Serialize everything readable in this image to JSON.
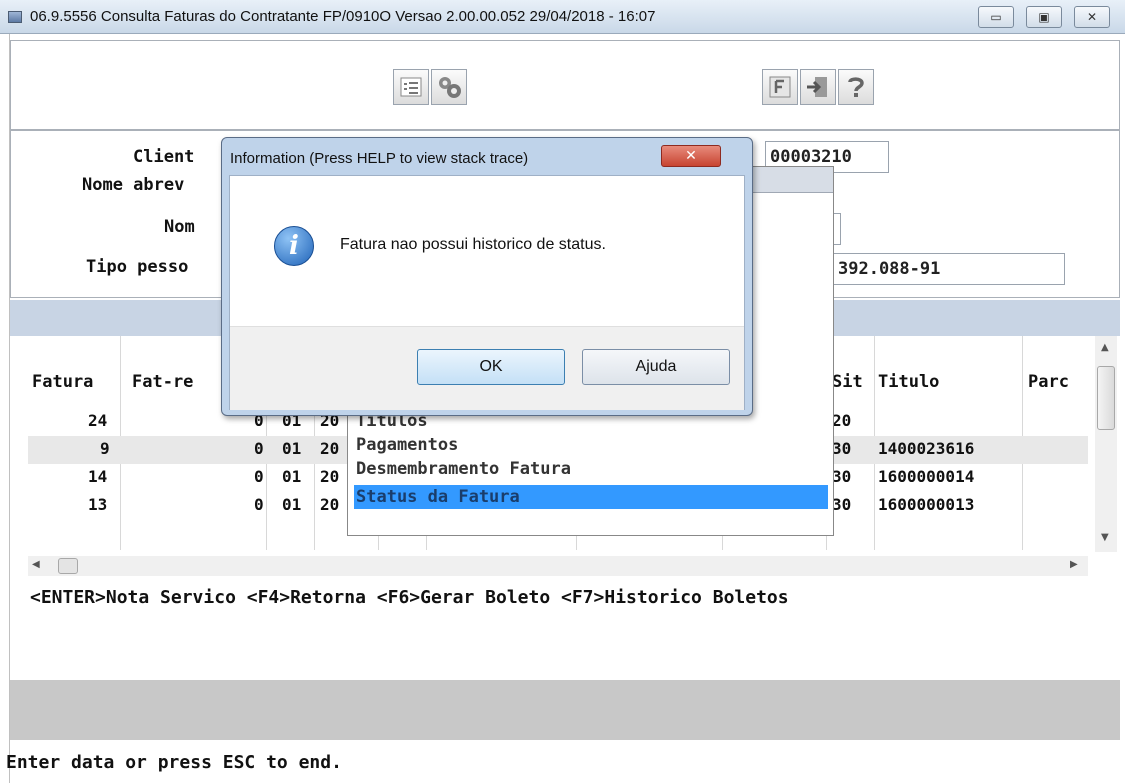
{
  "window": {
    "title": "06.9.5556 Consulta  Faturas do Contratante FP/0910O Versao 2.00.00.052 29/04/2018 - 16:07",
    "minimize": "▭",
    "maximize": "▣",
    "close": "✕"
  },
  "toolbar": {
    "icons": [
      "list-check-icon",
      "gears-icon",
      "first-icon",
      "exit-door-icon",
      "help-icon"
    ]
  },
  "header": {
    "labels": [
      "Client",
      "Nome abrev",
      "Nom",
      "Tipo pesso"
    ],
    "fields": [
      "00003210",
      "",
      "392.088-91"
    ]
  },
  "grid": {
    "columns": [
      "Fatura",
      "Fat-re",
      "Sit",
      "Titulo",
      "Parc"
    ],
    "rows": [
      {
        "fatura": "24",
        "fatre": "0",
        "c1": "01",
        "c2": "20",
        "sit": "20",
        "titulo": ""
      },
      {
        "fatura": "9",
        "fatre": "0",
        "c1": "01",
        "c2": "20",
        "sit": "30",
        "titulo": "1400023616"
      },
      {
        "fatura": "14",
        "fatre": "0",
        "c1": "01",
        "c2": "20",
        "sit": "30",
        "titulo": "1600000014"
      },
      {
        "fatura": "13",
        "fatre": "0",
        "c1": "01",
        "c2": "20",
        "sit": "30",
        "titulo": "1600000013"
      }
    ]
  },
  "menu": {
    "items": [
      "Titulos",
      "Pagamentos",
      "Desmembramento Fatura",
      "Status da Fatura"
    ]
  },
  "dialog": {
    "title": "Information (Press HELP to view stack trace)",
    "close": "✕",
    "message": "Fatura nao possui historico de status.",
    "ok": "OK",
    "help": "Ajuda",
    "icon": "information-icon"
  },
  "hotkeys": "<ENTER>Nota Servico <F4>Retorna <F6>Gerar Boleto <F7>Historico Boletos",
  "status": "Enter data or press ESC to end."
}
